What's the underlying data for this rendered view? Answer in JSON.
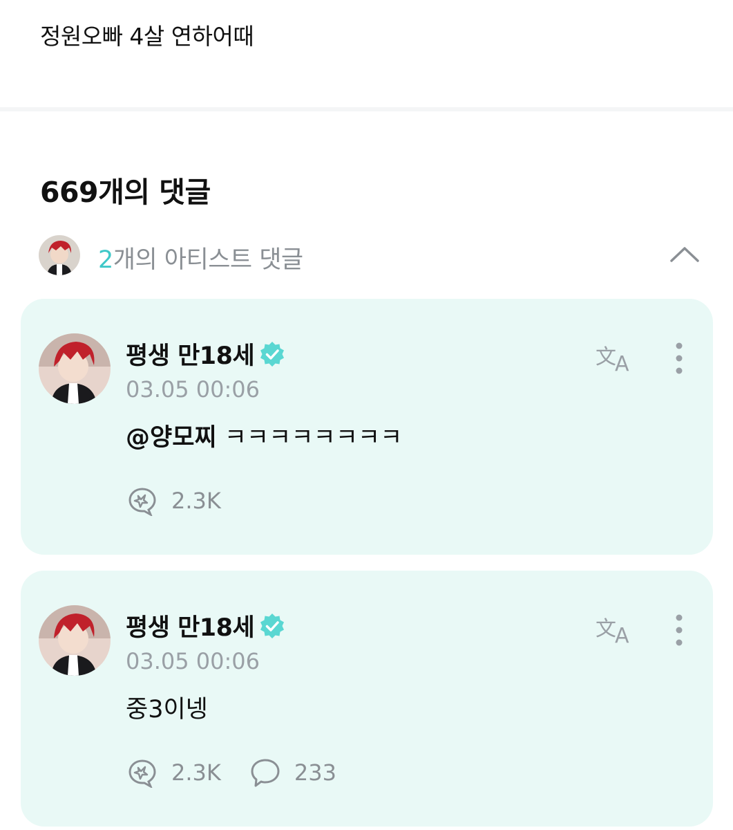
{
  "post": {
    "text": "정원오빠 4살 연하어때"
  },
  "comments_header": {
    "title": "669개의 댓글"
  },
  "artist_summary": {
    "count": "2",
    "label": "개의 아티스트 댓글"
  },
  "comments": [
    {
      "author": "평생 만18세",
      "timestamp": "03.05 00:06",
      "mention": "@양모찌",
      "text": " ㅋㅋㅋㅋㅋㅋㅋㅋ",
      "likes": "2.3K"
    },
    {
      "author": "평생 만18세",
      "timestamp": "03.05 00:06",
      "mention": "",
      "text": "중3이넹",
      "likes": "2.3K",
      "replies": "233"
    }
  ],
  "icons": {
    "verified": "verified-badge-icon",
    "translate": "translate-icon",
    "more": "more-vertical-icon",
    "like": "cheer-bubble-icon",
    "reply": "speech-bubble-icon",
    "collapse": "chevron-up-icon"
  },
  "colors": {
    "accent": "#3fc8c8",
    "card_bg": "#e9f9f6",
    "verified": "#5ad7d2"
  }
}
